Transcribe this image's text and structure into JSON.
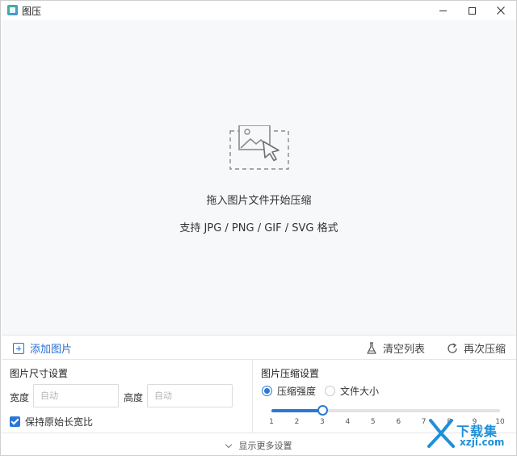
{
  "window": {
    "title": "图压"
  },
  "dropzone": {
    "hint": "拖入图片文件开始压缩",
    "formats": "支持 JPG / PNG / GIF / SVG 格式"
  },
  "toolbar": {
    "add_label": "添加图片",
    "clear_label": "清空列表",
    "recompress_label": "再次压缩"
  },
  "size_settings": {
    "title": "图片尺寸设置",
    "width_label": "宽度",
    "width_placeholder": "自动",
    "height_label": "高度",
    "height_placeholder": "自动",
    "keep_ratio_label": "保持原始长宽比",
    "keep_ratio_checked": true
  },
  "compress_settings": {
    "title": "图片压缩设置",
    "mode_strength_label": "压缩强度",
    "mode_size_label": "文件大小",
    "selected_mode": "压缩强度",
    "slider_value": 3,
    "slider_min": 1,
    "slider_max": 10,
    "ticks": [
      "1",
      "2",
      "3",
      "4",
      "5",
      "6",
      "7",
      "8",
      "9",
      "10"
    ]
  },
  "footer": {
    "more_settings_label": "显示更多设置"
  },
  "watermark": {
    "line1": "下载集",
    "line2": "xzji.com"
  },
  "colors": {
    "accent": "#2a78d6",
    "link": "#2a6fcf",
    "dropzone_bg": "#f7f8fa"
  }
}
